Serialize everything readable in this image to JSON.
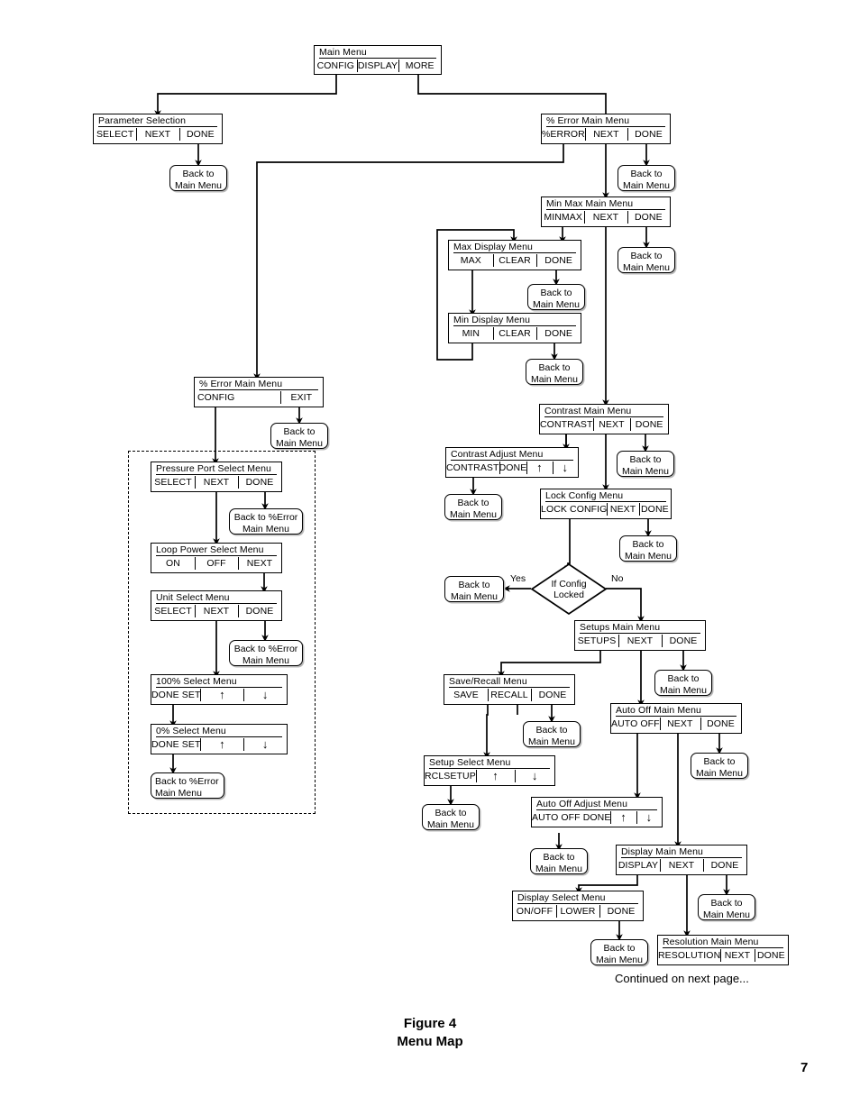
{
  "figure": {
    "caption_line1": "Figure 4",
    "caption_line2": "Menu Map",
    "page_number": "7",
    "continued_note": "Continued on next page..."
  },
  "labels": {
    "back_to": "Back to",
    "main_menu": "Main Menu",
    "back_to_pct_error": "Back to %Error",
    "yes": "Yes",
    "no": "No",
    "decision_line1": "If Config",
    "decision_line2": "Locked"
  },
  "menus": [
    {
      "id": "main-menu",
      "title": "Main Menu",
      "keys": [
        "CONFIG",
        "DISPLAY",
        "MORE"
      ]
    },
    {
      "id": "parameter-selection",
      "title": "Parameter Selection",
      "keys": [
        "SELECT",
        "NEXT",
        "DONE"
      ]
    },
    {
      "id": "pct-error-main-menu",
      "title": "% Error Main Menu",
      "keys": [
        "%ERROR",
        "NEXT",
        "DONE"
      ]
    },
    {
      "id": "min-max-main-menu",
      "title": "Min Max  Main Menu",
      "keys": [
        "MINMAX",
        "NEXT",
        "DONE"
      ]
    },
    {
      "id": "max-display-menu",
      "title": "Max Display Menu",
      "keys": [
        "MAX",
        "CLEAR",
        "DONE"
      ]
    },
    {
      "id": "min-display-menu",
      "title": "Min Display Menu",
      "keys": [
        "MIN",
        "CLEAR",
        "DONE"
      ]
    },
    {
      "id": "pct-error-config-menu",
      "title": "% Error Main Menu",
      "keys": [
        "CONFIG",
        "",
        "EXIT"
      ]
    },
    {
      "id": "pressure-port-select",
      "title": "Pressure Port Select Menu",
      "keys": [
        "SELECT",
        "NEXT",
        "DONE"
      ]
    },
    {
      "id": "loop-power-select",
      "title": "Loop Power Select Menu",
      "keys": [
        "ON",
        "OFF",
        "NEXT"
      ]
    },
    {
      "id": "unit-select-menu",
      "title": "Unit Select Menu",
      "keys": [
        "SELECT",
        "NEXT",
        "DONE"
      ]
    },
    {
      "id": "hundred-pct-select",
      "title": "100% Select Menu",
      "keys": [
        "DONE SET",
        "↑",
        "↓"
      ]
    },
    {
      "id": "zero-pct-select",
      "title": "0% Select Menu",
      "keys": [
        "DONE SET",
        "↑",
        "↓"
      ]
    },
    {
      "id": "contrast-main-menu",
      "title": "Contrast  Main Menu",
      "keys": [
        "CONTRAST",
        "NEXT",
        "DONE"
      ]
    },
    {
      "id": "contrast-adjust-menu",
      "title": "Contrast Adjust Menu",
      "keys": [
        "CONTRAST",
        "DONE",
        "↑",
        "↓"
      ]
    },
    {
      "id": "lock-config-menu",
      "title": "Lock Config  Menu",
      "keys": [
        "LOCK CONFIG",
        "NEXT",
        "DONE"
      ]
    },
    {
      "id": "setups-main-menu",
      "title": "Setups Main Menu",
      "keys": [
        "SETUPS",
        "NEXT",
        "DONE"
      ]
    },
    {
      "id": "save-recall-menu",
      "title": "Save/Recall Menu",
      "keys": [
        "SAVE",
        "RECALL",
        "DONE"
      ]
    },
    {
      "id": "setup-select-menu",
      "title": "Setup Select Menu",
      "keys": [
        "RCLSETUP",
        "↑",
        "↓"
      ]
    },
    {
      "id": "auto-off-main-menu",
      "title": "Auto Off Main Menu",
      "keys": [
        "AUTO OFF",
        "NEXT",
        "DONE"
      ]
    },
    {
      "id": "auto-off-adjust-menu",
      "title": "Auto Off Adjust Menu",
      "keys": [
        "AUTO OFF  DONE",
        "↑",
        "↓"
      ]
    },
    {
      "id": "display-main-menu",
      "title": "Display Main Menu",
      "keys": [
        "DISPLAY",
        "NEXT",
        "DONE"
      ]
    },
    {
      "id": "display-select-menu",
      "title": "Display Select Menu",
      "keys": [
        "ON/OFF",
        "LOWER",
        "DONE"
      ]
    },
    {
      "id": "resolution-main-menu",
      "title": "Resolution Main Menu",
      "keys": [
        "RESOLUTION",
        "NEXT",
        "DONE"
      ]
    }
  ],
  "return_nodes": [
    {
      "id": "ret-parameter",
      "line1": "Back to",
      "line2": "Main Menu"
    },
    {
      "id": "ret-pct-error",
      "line1": "Back to",
      "line2": "Main Menu"
    },
    {
      "id": "ret-min-max",
      "line1": "Back to",
      "line2": "Main Menu"
    },
    {
      "id": "ret-max-display",
      "line1": "Back to",
      "line2": "Main Menu"
    },
    {
      "id": "ret-min-display",
      "line1": "Back to",
      "line2": "Main Menu"
    },
    {
      "id": "ret-pct-config",
      "line1": "Back to",
      "line2": "Main Menu"
    },
    {
      "id": "ret-pressure-port",
      "line1": "Back to %Error",
      "line2": "Main Menu"
    },
    {
      "id": "ret-unit-select",
      "line1": "Back to %Error",
      "line2": "Main Menu"
    },
    {
      "id": "ret-zero-pct",
      "line1": "Back to %Error",
      "line2": "Main Menu"
    },
    {
      "id": "ret-contrast-main",
      "line1": "Back to",
      "line2": "Main Menu"
    },
    {
      "id": "ret-contrast-adjust",
      "line1": "Back to",
      "line2": "Main Menu"
    },
    {
      "id": "ret-lock-config",
      "line1": "Back to",
      "line2": "Main Menu"
    },
    {
      "id": "ret-config-locked",
      "line1": "Back to",
      "line2": "Main Menu"
    },
    {
      "id": "ret-setups",
      "line1": "Back to",
      "line2": "Main Menu"
    },
    {
      "id": "ret-save-recall",
      "line1": "Back to",
      "line2": "Main Menu"
    },
    {
      "id": "ret-setup-select",
      "line1": "Back to",
      "line2": "Main Menu"
    },
    {
      "id": "ret-auto-off-main",
      "line1": "Back to",
      "line2": "Main Menu"
    },
    {
      "id": "ret-auto-off-adj",
      "line1": "Back to",
      "line2": "Main Menu"
    },
    {
      "id": "ret-display-main",
      "line1": "Back to",
      "line2": "Main Menu"
    },
    {
      "id": "ret-display-select",
      "line1": "Back to",
      "line2": "Main Menu"
    }
  ],
  "colors": {
    "ink": "#000000",
    "paper": "#ffffff",
    "shadow": "#b9b9b9"
  }
}
